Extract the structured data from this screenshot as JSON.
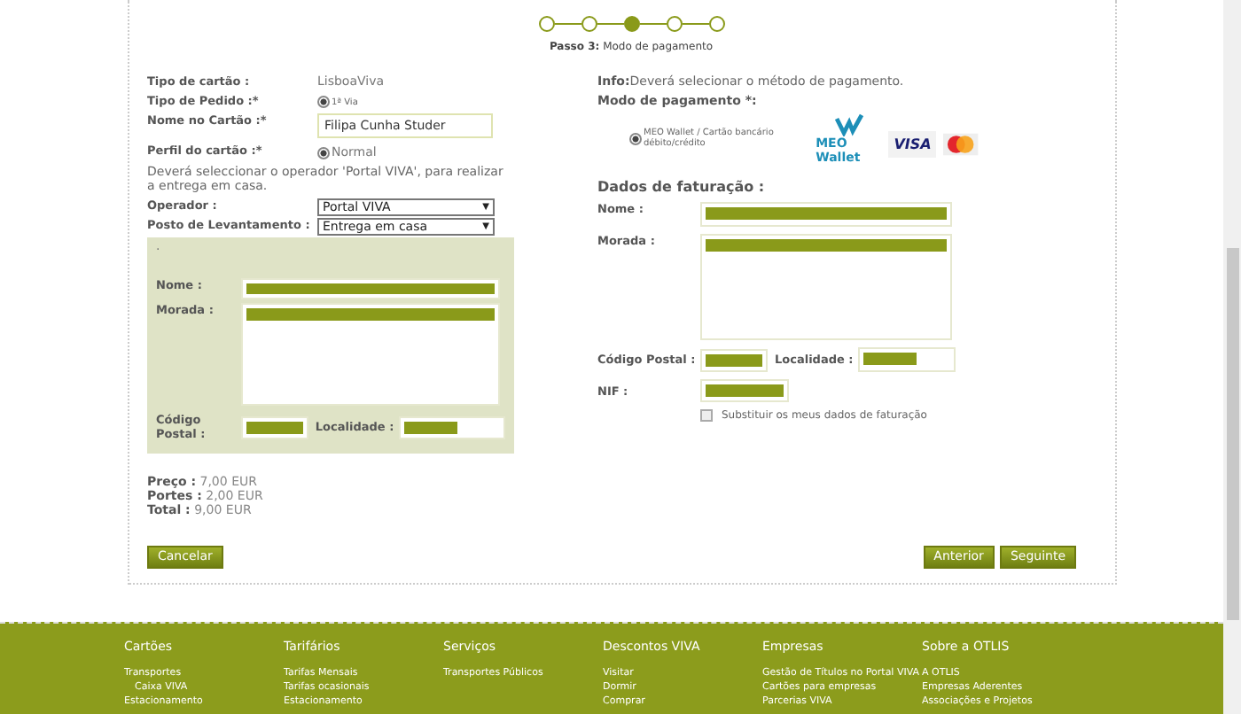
{
  "stepper": {
    "steps": [
      {
        "selected": false
      },
      {
        "selected": false
      },
      {
        "selected": true
      },
      {
        "selected": false
      },
      {
        "selected": false
      }
    ],
    "caption_label": "Passo 3:",
    "caption": "Modo de pagamento"
  },
  "card": {
    "rows": [
      {
        "kind": "text",
        "label": "Tipo de cartão :",
        "value": "LisboaViva"
      },
      {
        "kind": "radio",
        "label": "Tipo de Pedido :*",
        "value": "1ª Via",
        "selected": true
      },
      {
        "kind": "input",
        "label": "Nome no Cartão :*",
        "value": "Filipa Cunha Studer"
      },
      {
        "kind": "radio",
        "label": "Perfil do cartão :*",
        "value": "Normal",
        "selected": true
      }
    ],
    "note": "Deverá seleccionar o operador 'Portal VIVA', para realizar a entrega em casa.",
    "selects": [
      {
        "label": "Operador :",
        "value": "Portal VIVA",
        "caret": "▼"
      },
      {
        "label": "Posto de Levantamento :",
        "value": "Entrega em casa",
        "caret": "▼"
      }
    ]
  },
  "delivery": {
    "marker": ".",
    "name": {
      "label": "Nome :",
      "redacted": true
    },
    "address": {
      "label": "Morada :",
      "redacted": true
    },
    "postal": {
      "label": "Código Postal :",
      "redacted": true
    },
    "locality": {
      "label": "Localidade :",
      "redacted": true
    }
  },
  "totals": [
    {
      "label": "Preço :",
      "value": "7,00 EUR"
    },
    {
      "label": "Portes :",
      "value": "2,00 EUR"
    },
    {
      "label": "Total :",
      "value": "9,00 EUR"
    }
  ],
  "payment": {
    "info_label": "Info:",
    "info": "Deverá selecionar o método de pagamento.",
    "mode_label": "Modo de pagamento *:",
    "option": {
      "label": "MEO Wallet / Cartão bancário débito/crédito",
      "selected": true
    },
    "wallet_text": "MEO Wallet",
    "visa": "VISA"
  },
  "billing": {
    "title": "Dados de faturação :",
    "name": {
      "label": "Nome :",
      "redacted": true
    },
    "address": {
      "label": "Morada :",
      "redacted": true
    },
    "postal": {
      "label": "Código Postal :",
      "redacted": true
    },
    "locality": {
      "label": "Localidade :",
      "redacted": true
    },
    "nif": {
      "label": "NIF :",
      "redacted": true
    },
    "replace": {
      "label": "Substituir os meus dados de faturação",
      "checked": false
    }
  },
  "buttons": {
    "cancel": "Cancelar",
    "back": "Anterior",
    "next": "Seguinte"
  },
  "footer": [
    {
      "heading": "Cartões",
      "links": [
        {
          "label": "Transportes",
          "children": [
            {
              "label": "Caixa VIVA"
            }
          ]
        },
        {
          "label": "Estacionamento"
        }
      ]
    },
    {
      "heading": "Tarifários",
      "links": [
        {
          "label": "Tarifas Mensais"
        },
        {
          "label": "Tarifas ocasionais"
        },
        {
          "label": "Estacionamento"
        }
      ]
    },
    {
      "heading": "Serviços",
      "links": [
        {
          "label": "Transportes Públicos"
        }
      ]
    },
    {
      "heading": "Descontos VIVA",
      "links": [
        {
          "label": "Visitar"
        },
        {
          "label": "Dormir"
        },
        {
          "label": "Comprar"
        }
      ]
    },
    {
      "heading": "Empresas",
      "links": [
        {
          "label": "Gestão de Títulos no Portal VIVA"
        },
        {
          "label": "Cartões para empresas"
        },
        {
          "label": "Parcerias VIVA"
        }
      ]
    },
    {
      "heading": "Sobre a OTLIS",
      "links": [
        {
          "label": "A OTLIS"
        },
        {
          "label": "Empresas Aderentes"
        },
        {
          "label": "Associações e Projetos"
        }
      ]
    }
  ]
}
